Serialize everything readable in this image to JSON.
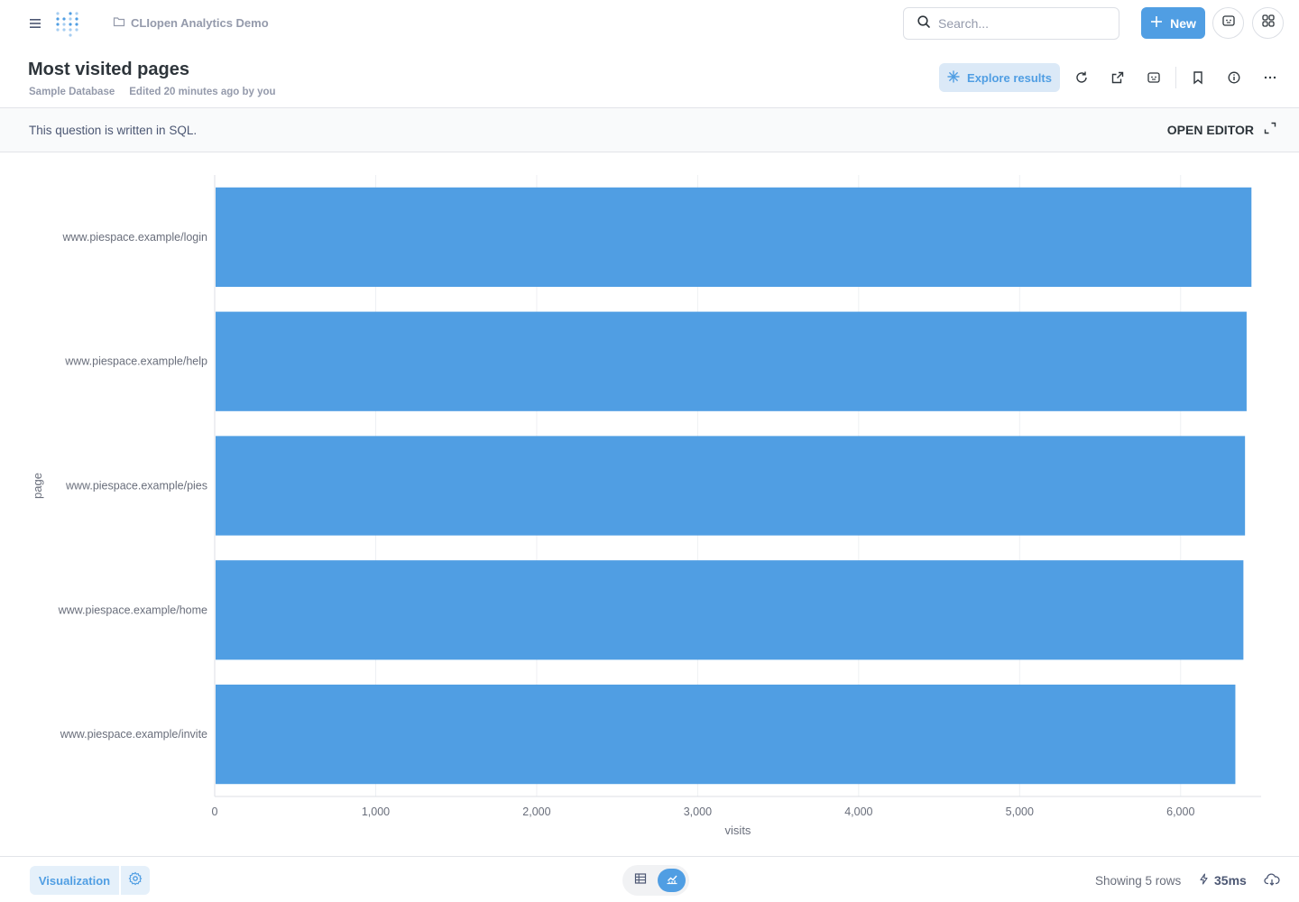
{
  "nav": {
    "collection": "CLIopen Analytics Demo",
    "search_placeholder": "Search...",
    "new_label": "New"
  },
  "header": {
    "title": "Most visited pages",
    "database": "Sample Database",
    "edited": "Edited 20 minutes ago by you",
    "explore_label": "Explore results"
  },
  "sql_bar": {
    "note": "This question is written in SQL.",
    "open_editor": "OPEN EDITOR"
  },
  "chart_data": {
    "type": "bar",
    "orientation": "horizontal",
    "categories": [
      "www.piespace.example/login",
      "www.piespace.example/help",
      "www.piespace.example/pies",
      "www.piespace.example/home",
      "www.piespace.example/invite"
    ],
    "values": [
      6440,
      6410,
      6400,
      6390,
      6340
    ],
    "xlabel": "visits",
    "ylabel": "page",
    "xlim": [
      0,
      6500
    ],
    "xticks": [
      0,
      1000,
      2000,
      3000,
      4000,
      5000,
      6000
    ],
    "xtick_labels": [
      "0",
      "1,000",
      "2,000",
      "3,000",
      "4,000",
      "5,000",
      "6,000"
    ],
    "grid": true,
    "bar_color": "#509ee3"
  },
  "footer": {
    "viz_label": "Visualization",
    "rows": "Showing 5 rows",
    "timing": "35ms"
  },
  "colors": {
    "brand": "#509ee3",
    "text_dark": "#2e353b",
    "text_medium": "#4c5773",
    "text_light": "#949aab"
  }
}
